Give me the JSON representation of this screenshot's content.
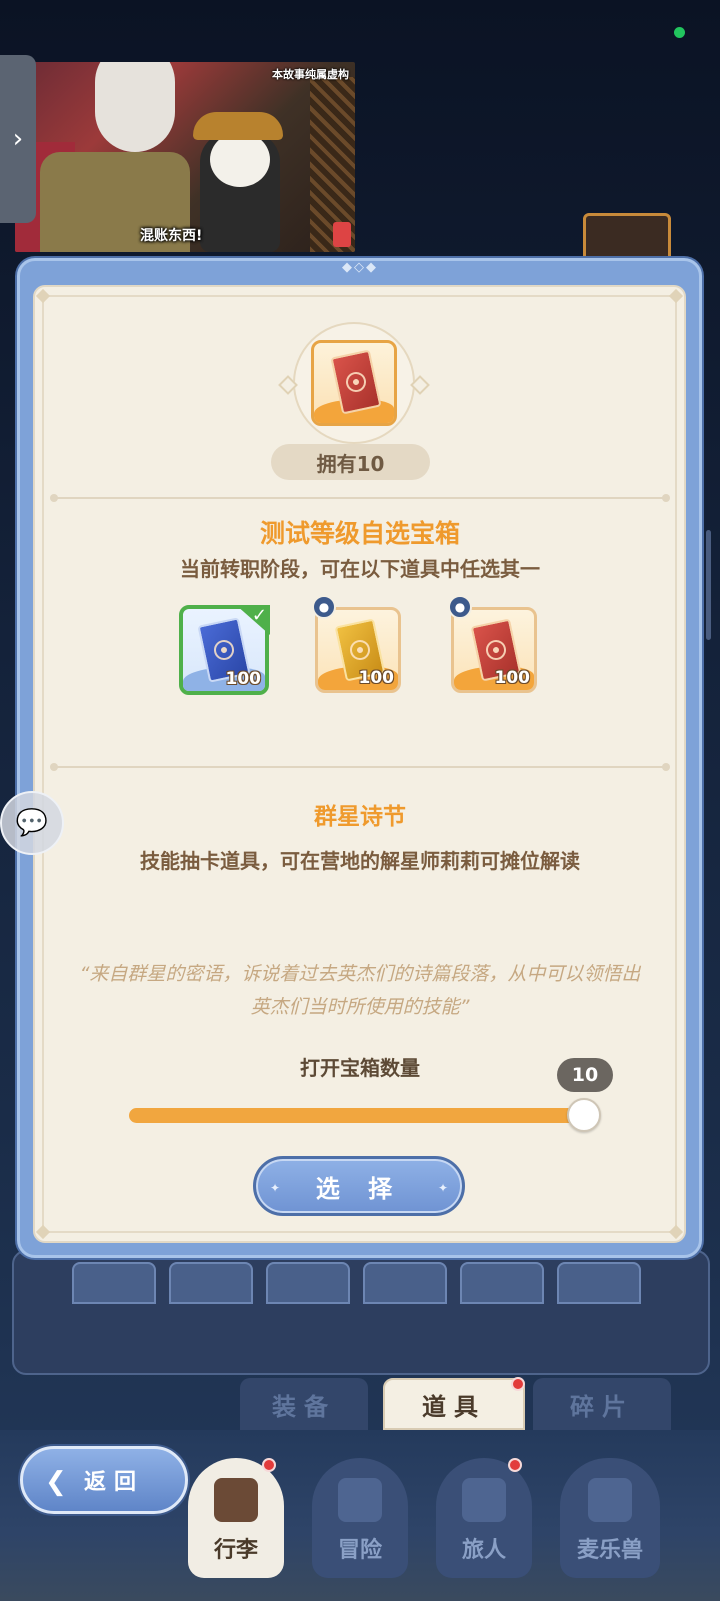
{
  "video": {
    "top_caption": "本故事纯属虚构",
    "sub_caption": "混账东西!"
  },
  "modal": {
    "owned_label": "拥有10",
    "item_name": "测试等级自选宝箱",
    "item_subtitle": "当前转职阶段，可在以下道具中任选其一",
    "options": [
      {
        "qty": "100",
        "color": "blue",
        "selected": true
      },
      {
        "qty": "100",
        "color": "gold",
        "locked": true
      },
      {
        "qty": "100",
        "color": "red",
        "locked": true
      }
    ],
    "detail_title": "群星诗节",
    "detail_desc": "技能抽卡道具，可在营地的解星师莉莉可摊位解读",
    "quote": "“来自群星的密语，诉说着过去英杰们的诗篇段落，从中可以领悟出英杰们当时所使用的技能”",
    "count_label": "打开宝箱数量",
    "count_value": "10",
    "count_value_number": 10,
    "count_max": 10,
    "select_label": "选 择"
  },
  "tabs": {
    "equipment": "装备",
    "items": "道具",
    "fragments": "碎片"
  },
  "nav": {
    "back": "返回",
    "luggage": "行李",
    "adventure": "冒险",
    "traveler": "旅人",
    "pet": "麦乐兽"
  },
  "colors": {
    "accent_orange": "#ef9a2d",
    "frame_blue": "#7ea2d8",
    "selected_green": "#4fb04a",
    "online_green": "#22c55e"
  }
}
